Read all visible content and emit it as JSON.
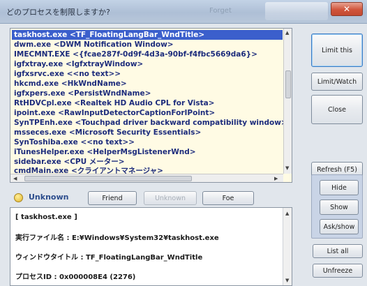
{
  "window": {
    "title": "どのプロセスを制限しますか?",
    "title_ghost": "Forget",
    "close_glyph": "✕"
  },
  "process_list": {
    "rows": [
      "taskhost.exe <TF_FloatingLangBar_WndTitle>",
      "dwm.exe <DWM Notification Window>",
      "IMECMNT.EXE <{fcae287f-0d9f-4d3a-90bf-f4fbc5669da6}>",
      "igfxtray.exe <IgfxtrayWindow>",
      "igfxsrvc.exe <<no text>>",
      "hkcmd.exe <HkWndName>",
      "igfxpers.exe <PersistWndName>",
      "RtHDVCpl.exe <Realtek HD Audio CPL for Vista>",
      "ipoint.exe <RawInputDetectorCaptionForIPoint>",
      "SynTPEnh.exe <Touchpad driver backward compatibility window>",
      "msseces.exe <Microsoft Security Essentials>",
      "SynToshiba.exe <<no text>>",
      "iTunesHelper.exe <HelperMsgListenerWnd>",
      "sidebar.exe <CPU メーター>",
      "cmdMain.exe <クライアントマネージャ>"
    ],
    "selected_index": 0
  },
  "status": {
    "label": "Unknown",
    "buttons": {
      "friend": "Friend",
      "unknown": "Unknown",
      "foe": "Foe"
    }
  },
  "info": {
    "lines": [
      "[ taskhost.exe ]",
      "実行ファイル名 : E:¥Windows¥System32¥taskhost.exe",
      "ウィンドウタイトル : TF_FloatingLangBar_WndTitle",
      "プロセスID : 0x000008E4 (2276)"
    ]
  },
  "side_buttons": {
    "limit_this": "Limit this",
    "limit_watch": "Limit/Watch",
    "close": "Close",
    "refresh": "Refresh (F5)",
    "hide": "Hide",
    "show": "Show",
    "ask_show": "Ask/show",
    "list_all": "List all",
    "unfreeze": "Unfreeze"
  },
  "colors": {
    "selection": "#3b5fcc",
    "list_text": "#1d2c7c",
    "list_bg": "#fffbe4",
    "status_label": "#2b4c8c"
  }
}
